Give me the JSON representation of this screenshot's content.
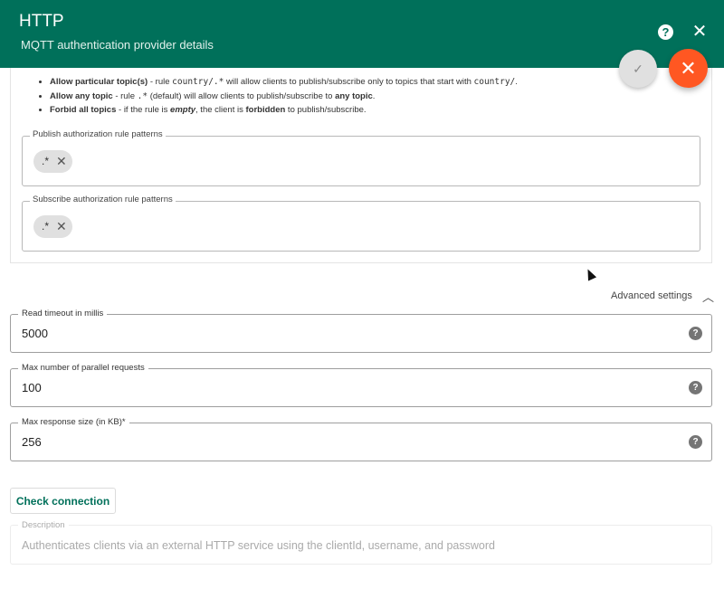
{
  "header": {
    "title": "HTTP",
    "subtitle": "MQTT authentication provider details"
  },
  "rules": [
    {
      "bold": "Allow particular topic(s)",
      "t1": " - rule ",
      "code": "country/.*",
      "t2": " will allow clients to publish/subscribe only to topics that start with ",
      "code2": "country/",
      "t3": "."
    },
    {
      "bold": "Allow any topic",
      "t1": " - rule ",
      "code": ".*",
      "t2": " (default) will allow clients to publish/subscribe to ",
      "bold2": "any topic",
      "t3": "."
    },
    {
      "bold": "Forbid all topics",
      "t1": " - if the rule is ",
      "italic": "empty",
      "t2": ", the client is ",
      "bold2": "forbidden",
      "t3": " to publish/subscribe."
    }
  ],
  "publish": {
    "label": "Publish authorization rule patterns",
    "chips": [
      ".*"
    ]
  },
  "subscribe": {
    "label": "Subscribe authorization rule patterns",
    "chips": [
      ".*"
    ]
  },
  "advanced": {
    "label": "Advanced settings"
  },
  "fields": {
    "read_timeout": {
      "label": "Read timeout in millis",
      "value": "5000"
    },
    "max_parallel": {
      "label": "Max number of parallel requests",
      "value": "100"
    },
    "max_response": {
      "label": "Max response size (in KB)*",
      "value": "256"
    }
  },
  "check_connection": {
    "label": "Check connection"
  },
  "description": {
    "label": "Description",
    "value": "Authenticates clients via an external HTTP service using the clientId, username, and password"
  },
  "icons": {
    "help": "help-icon",
    "close": "close-icon",
    "check": "check-icon",
    "hint": "help-circle-icon",
    "chevron": "chevron-up-icon",
    "chip_remove": "close-icon"
  },
  "colors": {
    "header": "#00705a",
    "accent_fab": "#ff5722",
    "primary_text": "#00705a"
  }
}
